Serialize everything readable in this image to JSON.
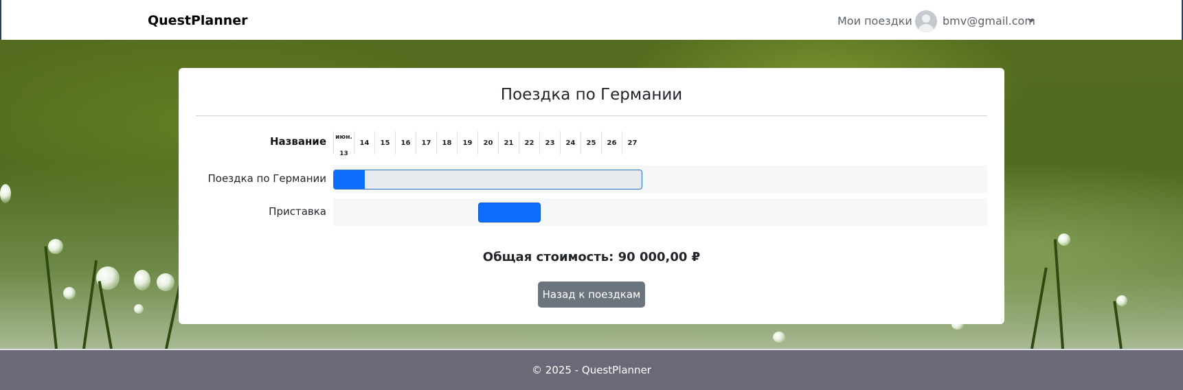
{
  "navbar": {
    "brand": "QuestPlanner",
    "my_trips_link": "Мои поездки",
    "user_email": "bmv@gmail.com",
    "avatar_icon": "user-avatar-icon",
    "dropdown_icon": "caret-down-icon"
  },
  "card": {
    "title": "Поездка по Германии",
    "gantt": {
      "name_header": "Название",
      "month_label": "июн.",
      "days": [
        "13",
        "14",
        "15",
        "16",
        "17",
        "18",
        "19",
        "20",
        "21",
        "22",
        "23",
        "24",
        "25",
        "26",
        "27"
      ],
      "rows": [
        {
          "label": "Поездка по Германии",
          "progress_percent": 10
        },
        {
          "label": "Приставка"
        }
      ]
    },
    "total": "Общая стоимость: 90 000,00 ₽",
    "back_button": "Назад к поездкам"
  },
  "colors": {
    "accent": "#0d6efd",
    "button": "#6c757d",
    "footer": "#6b6977"
  },
  "footer": {
    "text": "© 2025 - QuestPlanner"
  }
}
